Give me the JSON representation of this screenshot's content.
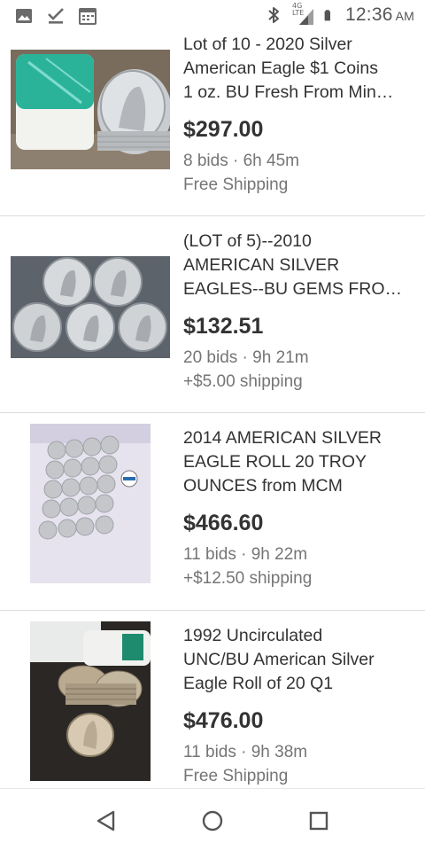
{
  "status_bar": {
    "time": "12:36",
    "ampm": "AM",
    "network_label": "4G LTE",
    "left_icons": [
      "image-icon",
      "check-download-icon",
      "calendar-icon"
    ],
    "right_icons": [
      "bluetooth-icon",
      "signal-icon",
      "battery-icon"
    ]
  },
  "listings": [
    {
      "title_lines": [
        "Lot of 10 - 2020 Silver",
        "American Eagle $1 Coins",
        "1 oz. BU Fresh From Min…"
      ],
      "price": "$297.00",
      "bids_time": "8 bids · 6h 45m",
      "shipping": "Free Shipping"
    },
    {
      "title_lines": [
        "(LOT of  5)--2010",
        "AMERICAN SILVER",
        "EAGLES--BU GEMS FRO…"
      ],
      "price": "$132.51",
      "bids_time": "20 bids · 9h 21m",
      "shipping": "+$5.00 shipping"
    },
    {
      "title_lines": [
        "2014 AMERICAN SILVER",
        "EAGLE ROLL 20 TROY",
        "OUNCES  from MCM"
      ],
      "price": "$466.60",
      "bids_time": "11 bids · 9h 22m",
      "shipping": "+$12.50 shipping"
    },
    {
      "title_lines": [
        "1992 Uncirculated",
        "UNC/BU American Silver",
        "Eagle Roll of 20 Q1"
      ],
      "price": "$476.00",
      "bids_time": "11 bids · 9h 38m",
      "shipping": "Free Shipping"
    }
  ],
  "nav_bar": {
    "icons": [
      "back-triangle-icon",
      "home-circle-icon",
      "recents-square-icon"
    ]
  },
  "colors": {
    "text": "#333333",
    "secondary_text": "#757575",
    "divider": "#dcdcdc"
  }
}
